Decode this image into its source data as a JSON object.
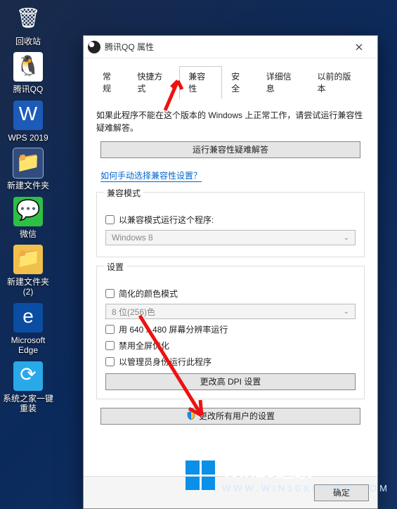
{
  "desktop": {
    "items": [
      {
        "name": "recycle-bin",
        "label": "回收站",
        "iconClass": "bin",
        "glyph": "🗑"
      },
      {
        "name": "tencent-qq",
        "label": "腾讯QQ",
        "iconClass": "qq",
        "glyph": "🐧"
      },
      {
        "name": "wps-2019",
        "label": "WPS 2019",
        "iconClass": "wps",
        "glyph": "W"
      },
      {
        "name": "new-folder",
        "label": "新建文件夹",
        "iconClass": "folder",
        "glyph": "📁",
        "selected": true
      },
      {
        "name": "wechat",
        "label": "微信",
        "iconClass": "wechat",
        "glyph": "💬"
      },
      {
        "name": "new-folder-2",
        "label": "新建文件夹 (2)",
        "iconClass": "folder",
        "glyph": "📁"
      },
      {
        "name": "microsoft-edge",
        "label": "Microsoft Edge",
        "iconClass": "edge",
        "glyph": "e"
      },
      {
        "name": "system-reinstall",
        "label": "系统之家一键重装",
        "iconClass": "sys",
        "glyph": "⟳"
      }
    ]
  },
  "dialog": {
    "title": "腾讯QQ 属性",
    "tabs": [
      "常规",
      "快捷方式",
      "兼容性",
      "安全",
      "详细信息",
      "以前的版本"
    ],
    "active_tab_index": 2,
    "intro": "如果此程序不能在这个版本的 Windows 上正常工作，请尝试运行兼容性疑难解答。",
    "run_troubleshooter": "运行兼容性疑难解答",
    "manual_link": "如何手动选择兼容性设置？",
    "compat_group": {
      "legend": "兼容模式",
      "checkbox": "以兼容模式运行这个程序:",
      "select_value": "Windows 8"
    },
    "settings_group": {
      "legend": "设置",
      "reduced_color": "简化的颜色模式",
      "color_select": "8 位(256)色",
      "run_640": "用 640 x 480 屏幕分辨率运行",
      "disable_fullscreen": "禁用全屏优化",
      "run_admin": "以管理员身份运行此程序",
      "high_dpi": "更改高 DPI 设置"
    },
    "all_users": "更改所有用户的设置",
    "footer": {
      "ok": "确定"
    }
  },
  "watermark": {
    "brand": "Win10",
    "suffix": "之家",
    "url": "WWW.WIN10XITONG.COM"
  }
}
